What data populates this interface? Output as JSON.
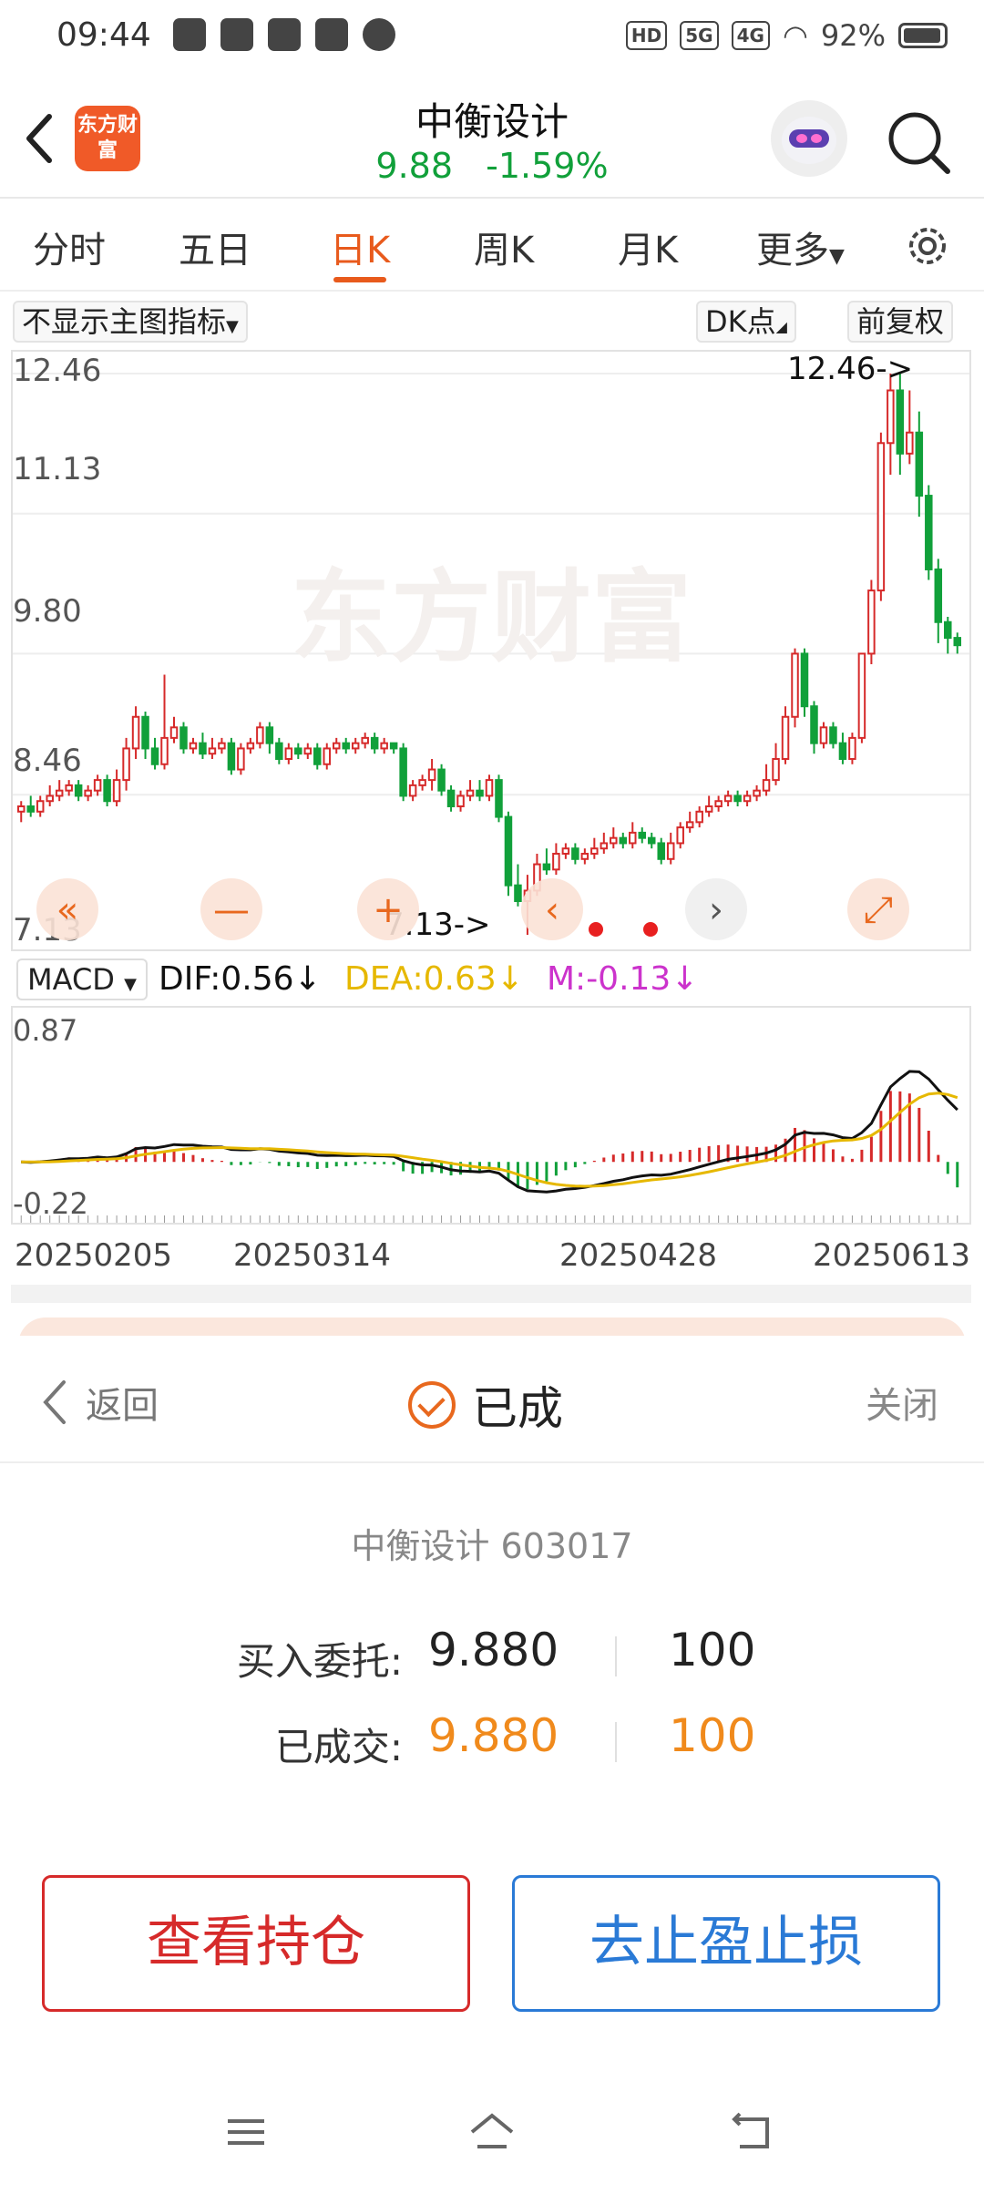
{
  "status_bar": {
    "time": "09:44",
    "tags": [
      "HD",
      "5G",
      "4G"
    ],
    "battery": "92%"
  },
  "header": {
    "logo_text": "东方财富",
    "stock_name": "中衡设计",
    "price": "9.88",
    "change_pct": "-1.59%"
  },
  "tabs": [
    "分时",
    "五日",
    "日K",
    "周K",
    "月K",
    "更多"
  ],
  "active_tab_index": 2,
  "toolbar": {
    "indicator_select": "不显示主图指标",
    "dk_point": "DK点",
    "fq": "前复权"
  },
  "kchart": {
    "watermark": "东方财富",
    "y_labels": [
      "12.46",
      "11.13",
      "9.80",
      "8.46",
      "7.13"
    ],
    "high_label": "12.46->",
    "low_label": "7.13->"
  },
  "macd": {
    "select": "MACD",
    "dif": "DIF:0.56↓",
    "dea": "DEA:0.63↓",
    "m": "M:-0.13↓",
    "y_max": "0.87",
    "y_min": "-0.22"
  },
  "chart_data": {
    "type": "candlestick",
    "ylim": [
      7.13,
      12.46
    ],
    "x_labels": [
      "20250205",
      "20250314",
      "20250428",
      "20250613"
    ],
    "candles": [
      [
        8.3,
        8.35,
        8.2,
        8.4
      ],
      [
        8.35,
        8.3,
        8.25,
        8.45
      ],
      [
        8.3,
        8.4,
        8.25,
        8.45
      ],
      [
        8.4,
        8.45,
        8.35,
        8.55
      ],
      [
        8.45,
        8.5,
        8.4,
        8.6
      ],
      [
        8.5,
        8.55,
        8.45,
        8.6
      ],
      [
        8.55,
        8.45,
        8.4,
        8.6
      ],
      [
        8.45,
        8.5,
        8.4,
        8.55
      ],
      [
        8.5,
        8.6,
        8.45,
        8.65
      ],
      [
        8.6,
        8.4,
        8.35,
        8.65
      ],
      [
        8.4,
        8.6,
        8.35,
        8.7
      ],
      [
        8.6,
        8.9,
        8.5,
        9.0
      ],
      [
        8.9,
        9.2,
        8.8,
        9.3
      ],
      [
        9.2,
        8.9,
        8.8,
        9.25
      ],
      [
        8.9,
        8.75,
        8.7,
        9.0
      ],
      [
        8.75,
        9.0,
        8.7,
        9.6
      ],
      [
        9.0,
        9.1,
        8.95,
        9.2
      ],
      [
        9.1,
        8.9,
        8.85,
        9.15
      ],
      [
        8.9,
        8.95,
        8.85,
        9.0
      ],
      [
        8.95,
        8.85,
        8.8,
        9.05
      ],
      [
        8.85,
        8.9,
        8.8,
        9.0
      ],
      [
        8.9,
        8.95,
        8.85,
        9.0
      ],
      [
        8.95,
        8.7,
        8.65,
        9.0
      ],
      [
        8.7,
        8.9,
        8.65,
        8.95
      ],
      [
        8.9,
        8.95,
        8.85,
        9.0
      ],
      [
        8.95,
        9.1,
        8.9,
        9.15
      ],
      [
        9.1,
        8.95,
        8.85,
        9.15
      ],
      [
        8.95,
        8.8,
        8.75,
        9.0
      ],
      [
        8.8,
        8.9,
        8.75,
        8.95
      ],
      [
        8.9,
        8.85,
        8.8,
        8.95
      ],
      [
        8.85,
        8.9,
        8.8,
        8.95
      ],
      [
        8.9,
        8.75,
        8.7,
        8.95
      ],
      [
        8.75,
        8.9,
        8.7,
        8.95
      ],
      [
        8.9,
        8.95,
        8.85,
        9.0
      ],
      [
        8.95,
        8.9,
        8.85,
        9.0
      ],
      [
        8.9,
        8.95,
        8.85,
        9.0
      ],
      [
        8.95,
        9.0,
        8.9,
        9.05
      ],
      [
        9.0,
        8.9,
        8.85,
        9.05
      ],
      [
        8.9,
        8.95,
        8.85,
        9.0
      ],
      [
        8.95,
        8.9,
        8.85,
        8.95
      ],
      [
        8.9,
        8.45,
        8.4,
        8.95
      ],
      [
        8.45,
        8.55,
        8.4,
        8.6
      ],
      [
        8.55,
        8.6,
        8.5,
        8.65
      ],
      [
        8.6,
        8.7,
        8.5,
        8.8
      ],
      [
        8.7,
        8.5,
        8.45,
        8.75
      ],
      [
        8.5,
        8.35,
        8.3,
        8.55
      ],
      [
        8.35,
        8.45,
        8.3,
        8.5
      ],
      [
        8.45,
        8.5,
        8.4,
        8.6
      ],
      [
        8.5,
        8.45,
        8.4,
        8.6
      ],
      [
        8.45,
        8.6,
        8.4,
        8.65
      ],
      [
        8.6,
        8.25,
        8.2,
        8.65
      ],
      [
        8.25,
        7.6,
        7.5,
        8.3
      ],
      [
        7.6,
        7.45,
        7.4,
        7.8
      ],
      [
        7.45,
        7.55,
        7.13,
        7.7
      ],
      [
        7.55,
        7.8,
        7.5,
        7.9
      ],
      [
        7.8,
        7.75,
        7.7,
        7.95
      ],
      [
        7.75,
        7.9,
        7.7,
        8.0
      ],
      [
        7.9,
        7.95,
        7.85,
        8.0
      ],
      [
        7.95,
        7.85,
        7.8,
        8.0
      ],
      [
        7.85,
        7.9,
        7.8,
        7.95
      ],
      [
        7.9,
        7.95,
        7.85,
        8.05
      ],
      [
        7.95,
        8.0,
        7.9,
        8.1
      ],
      [
        8.0,
        8.05,
        7.95,
        8.15
      ],
      [
        8.05,
        8.0,
        7.95,
        8.1
      ],
      [
        8.0,
        8.1,
        7.95,
        8.2
      ],
      [
        8.1,
        8.05,
        8.0,
        8.15
      ],
      [
        8.05,
        8.0,
        7.95,
        8.1
      ],
      [
        8.0,
        7.85,
        7.8,
        8.05
      ],
      [
        7.85,
        8.0,
        7.8,
        8.1
      ],
      [
        8.0,
        8.15,
        7.95,
        8.2
      ],
      [
        8.15,
        8.2,
        8.1,
        8.3
      ],
      [
        8.2,
        8.3,
        8.15,
        8.35
      ],
      [
        8.3,
        8.35,
        8.25,
        8.45
      ],
      [
        8.35,
        8.4,
        8.3,
        8.45
      ],
      [
        8.4,
        8.45,
        8.35,
        8.5
      ],
      [
        8.45,
        8.4,
        8.35,
        8.5
      ],
      [
        8.4,
        8.45,
        8.35,
        8.5
      ],
      [
        8.45,
        8.5,
        8.4,
        8.55
      ],
      [
        8.5,
        8.6,
        8.45,
        8.75
      ],
      [
        8.6,
        8.8,
        8.55,
        8.95
      ],
      [
        8.8,
        9.2,
        8.75,
        9.3
      ],
      [
        9.2,
        9.8,
        9.1,
        9.85
      ],
      [
        9.8,
        9.3,
        9.2,
        9.85
      ],
      [
        9.3,
        8.95,
        8.85,
        9.35
      ],
      [
        8.95,
        9.1,
        8.9,
        9.15
      ],
      [
        9.1,
        8.95,
        8.9,
        9.15
      ],
      [
        8.95,
        8.8,
        8.75,
        9.05
      ],
      [
        8.8,
        9.0,
        8.75,
        9.05
      ],
      [
        9.0,
        9.8,
        8.95,
        9.8
      ],
      [
        9.8,
        10.4,
        9.7,
        10.5
      ],
      [
        10.4,
        11.8,
        10.3,
        11.9
      ],
      [
        11.8,
        12.3,
        11.5,
        12.46
      ],
      [
        12.3,
        11.7,
        11.5,
        12.46
      ],
      [
        11.7,
        11.9,
        11.6,
        12.3
      ],
      [
        11.9,
        11.3,
        11.1,
        12.1
      ],
      [
        11.3,
        10.6,
        10.5,
        11.4
      ],
      [
        10.6,
        10.1,
        9.9,
        10.7
      ],
      [
        10.1,
        9.95,
        9.8,
        10.15
      ],
      [
        9.95,
        9.88,
        9.8,
        10.0
      ]
    ]
  },
  "dialog": {
    "back": "返回",
    "title": "已成",
    "close": "关闭",
    "stock": "中衡设计 603017",
    "entrust_label": "买入委托:",
    "entrust_price": "9.880",
    "entrust_qty": "100",
    "filled_label": "已成交:",
    "filled_price": "9.880",
    "filled_qty": "100",
    "btn_position": "查看持仓",
    "btn_stoploss": "去止盈止损"
  },
  "colors": {
    "accent": "#e85a1c",
    "rise": "#d62a2a",
    "fall": "#11a03a",
    "dif": "#111111",
    "dea": "#e6b800",
    "m": "#cc33cc"
  }
}
